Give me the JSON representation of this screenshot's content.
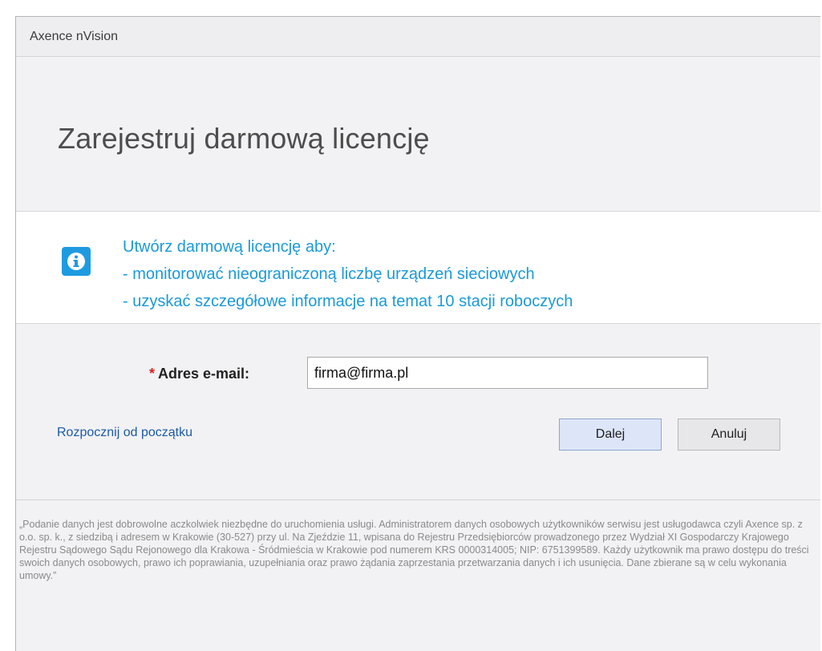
{
  "window": {
    "title": "Axence nVision"
  },
  "header": {
    "title": "Zarejestruj darmową licencję"
  },
  "info": {
    "icon": "info-icon",
    "lines": [
      "Utwórz darmową licencję aby:",
      "- monitorować nieograniczoną liczbę urządzeń sieciowych",
      "- uzyskać szczegółowe informacje na temat 10 stacji roboczych"
    ]
  },
  "form": {
    "required_marker": "*",
    "email_label": "Adres e-mail:",
    "email_value": "firma@firma.pl"
  },
  "actions": {
    "restart_link": "Rozpocznij od początku",
    "next_label": "Dalej",
    "cancel_label": "Anuluj"
  },
  "footer": {
    "disclaimer": "„Podanie danych jest dobrowolne aczkolwiek niezbędne do uruchomienia usługi. Administratorem danych osobowych użytkowników serwisu jest usługodawca czyli Axence sp. z o.o. sp. k., z siedzibą i adresem w Krakowie (30-527) przy ul. Na Zjeździe 11, wpisana do Rejestru Przedsiębiorców prowadzonego przez Wydział XI Gospodarczy Krajowego Rejestru Sądowego Sądu Rejonowego dla Krakowa - Śródmieścia w Krakowie pod numerem KRS 0000314005; NIP: 6751399589. Każdy użytkownik ma prawo dostępu do treści swoich danych osobowych, prawo ich poprawiania, uzupełniania oraz prawo żądania zaprzestania przetwarzania danych i ich usunięcia. Dane zbierane są w celu wykonania umowy.”"
  },
  "colors": {
    "accent": "#1a9ad9",
    "link": "#1c5aa6",
    "required": "#e02020",
    "primary_button": "#dde6f8"
  }
}
